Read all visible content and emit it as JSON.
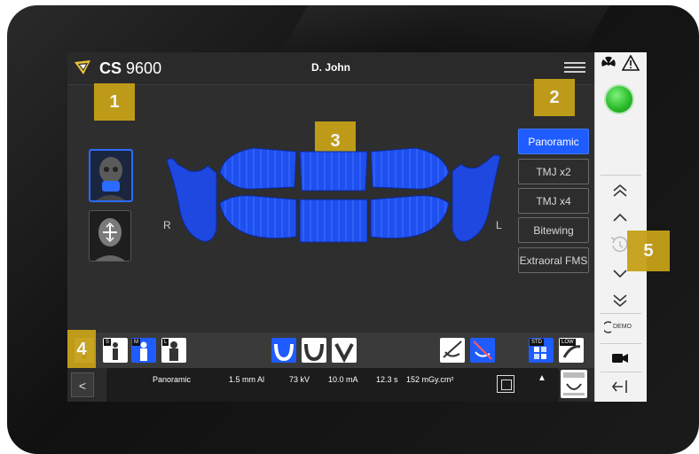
{
  "header": {
    "brand_bold": "CS",
    "brand_model": "9600",
    "patient_name": "D. John"
  },
  "callouts": [
    "1",
    "2",
    "3",
    "4",
    "5"
  ],
  "side_labels": {
    "right": "R",
    "left": "L"
  },
  "exam_types": [
    {
      "label": "Panoramic",
      "active": true
    },
    {
      "label": "TMJ x2",
      "active": false
    },
    {
      "label": "TMJ x4",
      "active": false
    },
    {
      "label": "Bitewing",
      "active": false
    },
    {
      "label": "Extraoral FMS",
      "active": false
    }
  ],
  "toolbar": {
    "patient_sizes": [
      "S",
      "M",
      "L"
    ],
    "selected_size": "M",
    "std_label": "STD",
    "low_label": "LOW"
  },
  "info_bar": {
    "back_label": "<",
    "exam": "Panoramic",
    "filtration": "1.5 mm Al",
    "voltage": "73 kV",
    "current": "10.0 mA",
    "time": "12.3 s",
    "dose": "152 mGy.cm²",
    "up_arrow": "▲"
  },
  "right_panel": {
    "demo_label": "DEMO",
    "status_color": "#2dbd2d"
  },
  "colors": {
    "accent": "#1f5cff",
    "callout": "#c5a118",
    "screen_bg": "#2e2e2e"
  }
}
